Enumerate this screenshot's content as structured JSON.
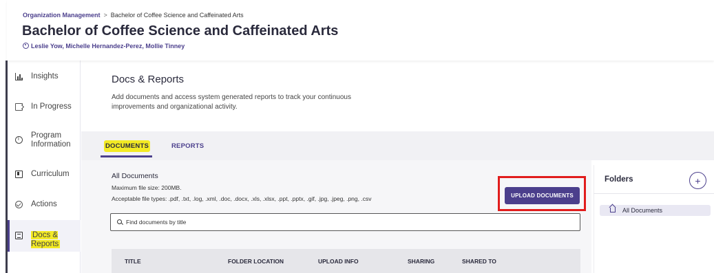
{
  "header": {
    "breadcrumb_root": "Organization Management",
    "breadcrumb_separator": ">",
    "breadcrumb_current": "Bachelor of Coffee Science and Caffeinated Arts",
    "title": "Bachelor of Coffee Science and Caffeinated Arts",
    "people": "Leslie Yow, Michelle Hernandez-Perez, Mollie Tinney"
  },
  "sidebar": {
    "items": [
      {
        "label": "Insights",
        "icon": "bar-chart-icon"
      },
      {
        "label": "In Progress",
        "icon": "progress-icon"
      },
      {
        "label": "Program Information",
        "icon": "info-icon"
      },
      {
        "label": "Curriculum",
        "icon": "bookmark-icon"
      },
      {
        "label": "Actions",
        "icon": "check-circle-icon"
      },
      {
        "label": "Docs & Reports",
        "icon": "document-icon",
        "active": true
      }
    ],
    "highlight_color": "#f3ea24"
  },
  "content": {
    "title": "Docs & Reports",
    "description": "Add documents and access system generated reports to track your continuous improvements and organizational activity."
  },
  "tabs": [
    {
      "label": "DOCUMENTS",
      "active": true
    },
    {
      "label": "REPORTS",
      "active": false
    }
  ],
  "documents": {
    "heading": "All Documents",
    "max_size": "Maximum file size: 200MB.",
    "file_types": "Acceptable file types: .pdf, .txt, .log, .xml, .doc, .docx, .xls, .xlsx, .ppt, .pptx, .gif, .jpg, .jpeg, .png, .csv",
    "upload_label": "UPLOAD DOCUMENTS",
    "search_placeholder": "Find documents by title",
    "columns": [
      "TITLE",
      "FOLDER LOCATION",
      "UPLOAD INFO",
      "SHARING",
      "SHARED TO"
    ]
  },
  "folders": {
    "title": "Folders",
    "add_label": "+",
    "items": [
      {
        "label": "All Documents",
        "icon": "home-icon"
      }
    ]
  },
  "colors": {
    "accent": "#4b3f8c",
    "annotation_box": "#e11c1c",
    "annotation_highlight": "#f3ea24"
  }
}
